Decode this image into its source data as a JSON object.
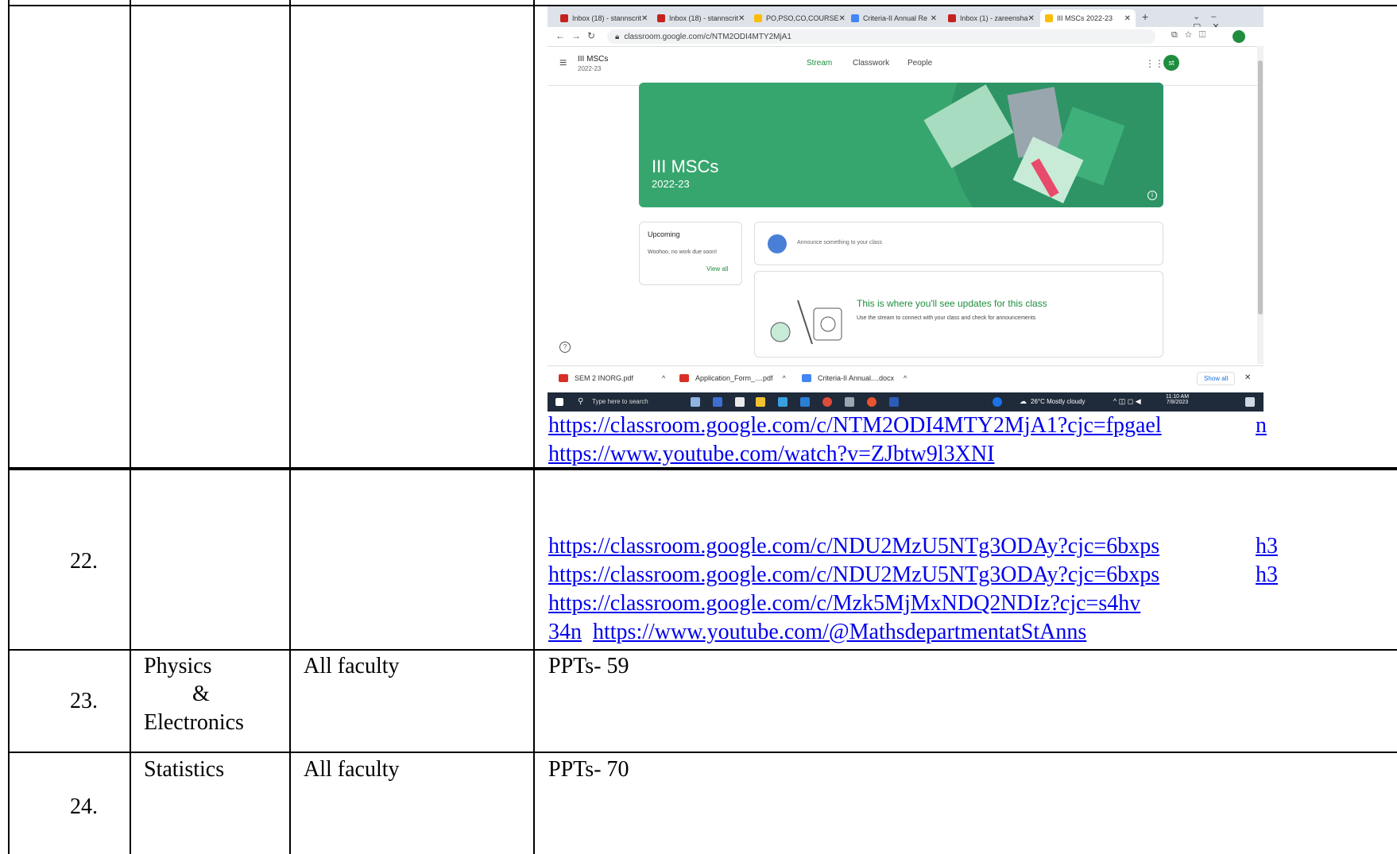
{
  "rows": [
    {
      "num": "",
      "dept": "",
      "faculty": ""
    },
    {
      "num": "22.",
      "dept": "",
      "faculty": "",
      "links": [
        "https://classroom.google.com/c/NDU2MzU5NTg3ODAy?cjc=6bxps",
        "h3",
        "https://classroom.google.com/c/NDU2MzU5NTg3ODAy?cjc=6bxps",
        "h3",
        "https://classroom.google.com/c/Mzk5MjMxNDQ2NDIz?cjc=s4hv",
        "34n",
        "https://www.youtube.com/@MathsdepartmentatStAnns"
      ]
    },
    {
      "num": "23.",
      "dept_line1": "Physics",
      "dept_line2": "&",
      "dept_line3": "Electronics",
      "faculty": "All faculty",
      "content": "PPTs- 59"
    },
    {
      "num": "24.",
      "dept": "Statistics",
      "faculty": "All faculty",
      "content": "PPTs- 70"
    }
  ],
  "row1_links": [
    "https://classroom.google.com/c/NTM2ODI4MTY2MjA1?cjc=fpgael",
    "n",
    "https://www.youtube.com/watch?v=ZJbtw9l3XNI"
  ],
  "screenshot": {
    "tabs": [
      "Inbox (18) - stannscrit",
      "Inbox (18) - stannscrit",
      "PO,PSO,CO,COURSE",
      "Criteria-II Annual Re",
      "Inbox (1) - zareensha",
      "III MSCs 2022-23"
    ],
    "url": "classroom.google.com/c/NTM2ODI4MTY2MjA1",
    "class_name": "III MSCs",
    "class_year": "2022-23",
    "nav": [
      "Stream",
      "Classwork",
      "People"
    ],
    "avatar": "st",
    "banner_title": "III MSCs",
    "banner_subtitle": "2022-23",
    "upcoming_title": "Upcoming",
    "upcoming_text": "Woohoo, no work due soon!",
    "view_all": "View all",
    "announce_placeholder": "Announce something to your class",
    "updates_title": "This is where you'll see updates for this class",
    "updates_text": "Use the stream to connect with your class and check for announcements",
    "downloads": [
      "SEM 2 INORG.pdf",
      "Application_Form_....pdf",
      "Criteria-II Annual....docx"
    ],
    "show_all": "Show all",
    "search_placeholder": "Type here to search",
    "weather": "26°C  Mostly cloudy",
    "time": "11:10 AM",
    "date": "7/8/2023",
    "colors": {
      "accent_green": "#37a66e",
      "stream_green": "#1e8e3e"
    }
  }
}
